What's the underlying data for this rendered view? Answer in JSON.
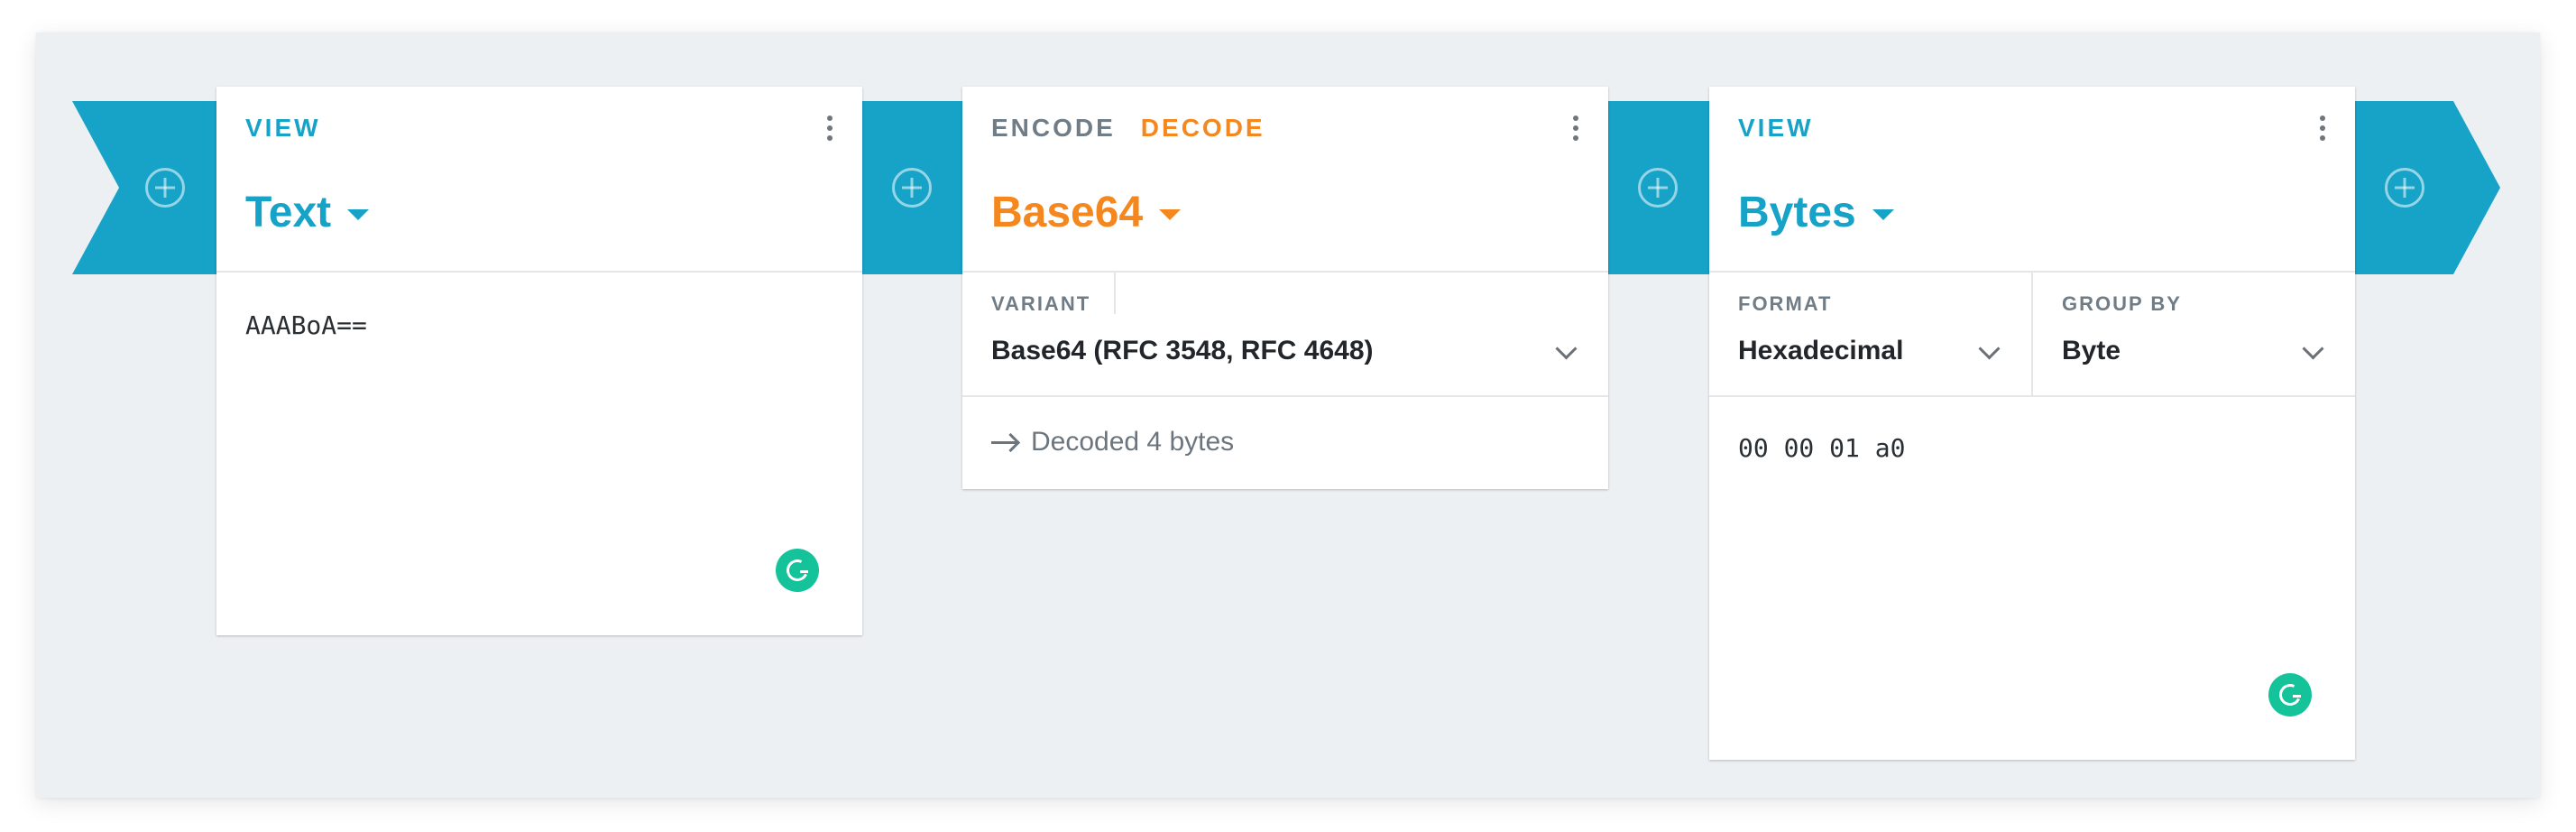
{
  "colors": {
    "accent_blue": "#17a2c7",
    "accent_orange": "#f5871f",
    "background": "#edf0f3",
    "card": "#ffffff",
    "grammarly": "#15c39a"
  },
  "cards": [
    {
      "tabs": [
        {
          "label": "VIEW",
          "active": true
        }
      ],
      "title": "Text",
      "content": "AAABoA=="
    },
    {
      "tabs": [
        {
          "label": "ENCODE",
          "active": false
        },
        {
          "label": "DECODE",
          "active": true
        }
      ],
      "title": "Base64",
      "settings": [
        {
          "label": "VARIANT",
          "value": "Base64 (RFC 3548, RFC 4648)"
        }
      ],
      "status": "Decoded 4 bytes"
    },
    {
      "tabs": [
        {
          "label": "VIEW",
          "active": true
        }
      ],
      "title": "Bytes",
      "settings": [
        {
          "label": "FORMAT",
          "value": "Hexadecimal"
        },
        {
          "label": "GROUP BY",
          "value": "Byte"
        }
      ],
      "content": "00 00 01 a0"
    }
  ],
  "icons": {
    "add": "plus-circle-icon",
    "menu": "more-vertical-icon",
    "caret": "caret-down-icon",
    "chevron": "chevron-down-icon",
    "arrow": "arrow-right-icon",
    "grammarly": "grammarly-icon"
  }
}
